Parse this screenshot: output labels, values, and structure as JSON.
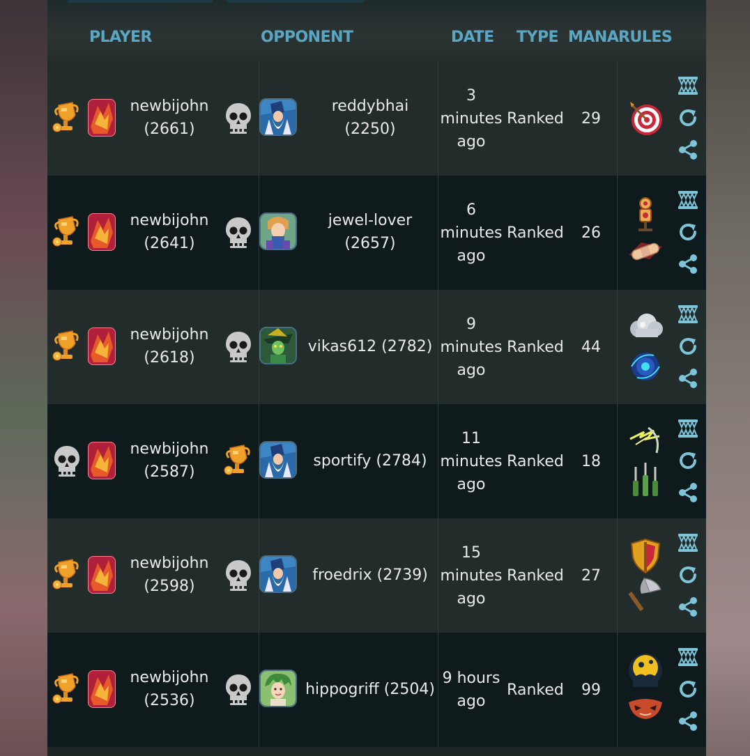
{
  "headers": {
    "player": "PLAYER",
    "opponent": "OPPONENT",
    "date": "DATE",
    "type": "TYPE",
    "mana": "MANA",
    "rules": "RULES"
  },
  "colors": {
    "header_text": "#5aa7c4",
    "row_light": "#222c2b",
    "row_dark": "#0f1a1c",
    "text": "#eaeaea",
    "icon_gray": "#c9c9c9"
  },
  "battles": [
    {
      "player_result_icon": "trophy-icon",
      "player_name": "newbijohn",
      "player_rating": "(2661)",
      "opponent_result_icon": "skull-icon",
      "opponent_avatar": "wizard-blue-avatar",
      "opponent_name_line1": "reddybhai (2250)",
      "opponent_name_line2": "",
      "date_line1": "3",
      "date_line2": "minutes",
      "date_line3": "ago",
      "type": "Ranked",
      "mana": "29",
      "rule_icons": [
        "target-rule-icon"
      ]
    },
    {
      "player_result_icon": "trophy-icon",
      "player_name": "newbijohn",
      "player_rating": "(2641)",
      "opponent_result_icon": "skull-icon",
      "opponent_avatar": "young-mage-avatar",
      "opponent_name_line1": "jewel-lover",
      "opponent_name_line2": "(2657)",
      "date_line1": "6",
      "date_line2": "minutes",
      "date_line3": "ago",
      "type": "Ranked",
      "mana": "26",
      "rule_icons": [
        "dummy-target-rule-icon",
        "bandage-rule-icon"
      ]
    },
    {
      "player_result_icon": "trophy-icon",
      "player_name": "newbijohn",
      "player_rating": "(2618)",
      "opponent_result_icon": "skull-icon",
      "opponent_avatar": "forest-druid-avatar",
      "opponent_name_line1": "vikas612 (2782)",
      "opponent_name_line2": "",
      "date_line1": "9",
      "date_line2": "minutes",
      "date_line3": "ago",
      "type": "Ranked",
      "mana": "44",
      "rule_icons": [
        "cloud-rule-icon",
        "vortex-rule-icon"
      ]
    },
    {
      "player_result_icon": "skull-icon",
      "player_name": "newbijohn",
      "player_rating": "(2587)",
      "opponent_result_icon": "trophy-icon",
      "opponent_avatar": "wizard-blue-avatar",
      "opponent_name_line1": "sportify (2784)",
      "opponent_name_line2": "",
      "date_line1": "11",
      "date_line2": "minutes",
      "date_line3": "ago",
      "type": "Ranked",
      "mana": "18",
      "rule_icons": [
        "lightning-rule-icon",
        "claws-rule-icon"
      ]
    },
    {
      "player_result_icon": "trophy-icon",
      "player_name": "newbijohn",
      "player_rating": "(2598)",
      "opponent_result_icon": "skull-icon",
      "opponent_avatar": "wizard-blue-avatar",
      "opponent_name_line1": "froedrix (2739)",
      "opponent_name_line2": "",
      "date_line1": "15",
      "date_line2": "minutes",
      "date_line3": "ago",
      "type": "Ranked",
      "mana": "27",
      "rule_icons": [
        "shield-rule-icon",
        "axe-rule-icon"
      ]
    },
    {
      "player_result_icon": "trophy-icon",
      "player_name": "newbijohn",
      "player_rating": "(2536)",
      "opponent_result_icon": "skull-icon",
      "opponent_avatar": "green-hair-avatar",
      "opponent_name_line1": "hippogriff (2504)",
      "opponent_name_line2": "",
      "date_line1": "9 hours",
      "date_line2": "ago",
      "date_line3": "",
      "type": "Ranked",
      "mana": "99",
      "rule_icons": [
        "moon-rule-icon",
        "mask-rule-icon"
      ]
    }
  ],
  "action_icons": [
    "monster-teeth-icon",
    "replay-icon",
    "share-icon"
  ]
}
